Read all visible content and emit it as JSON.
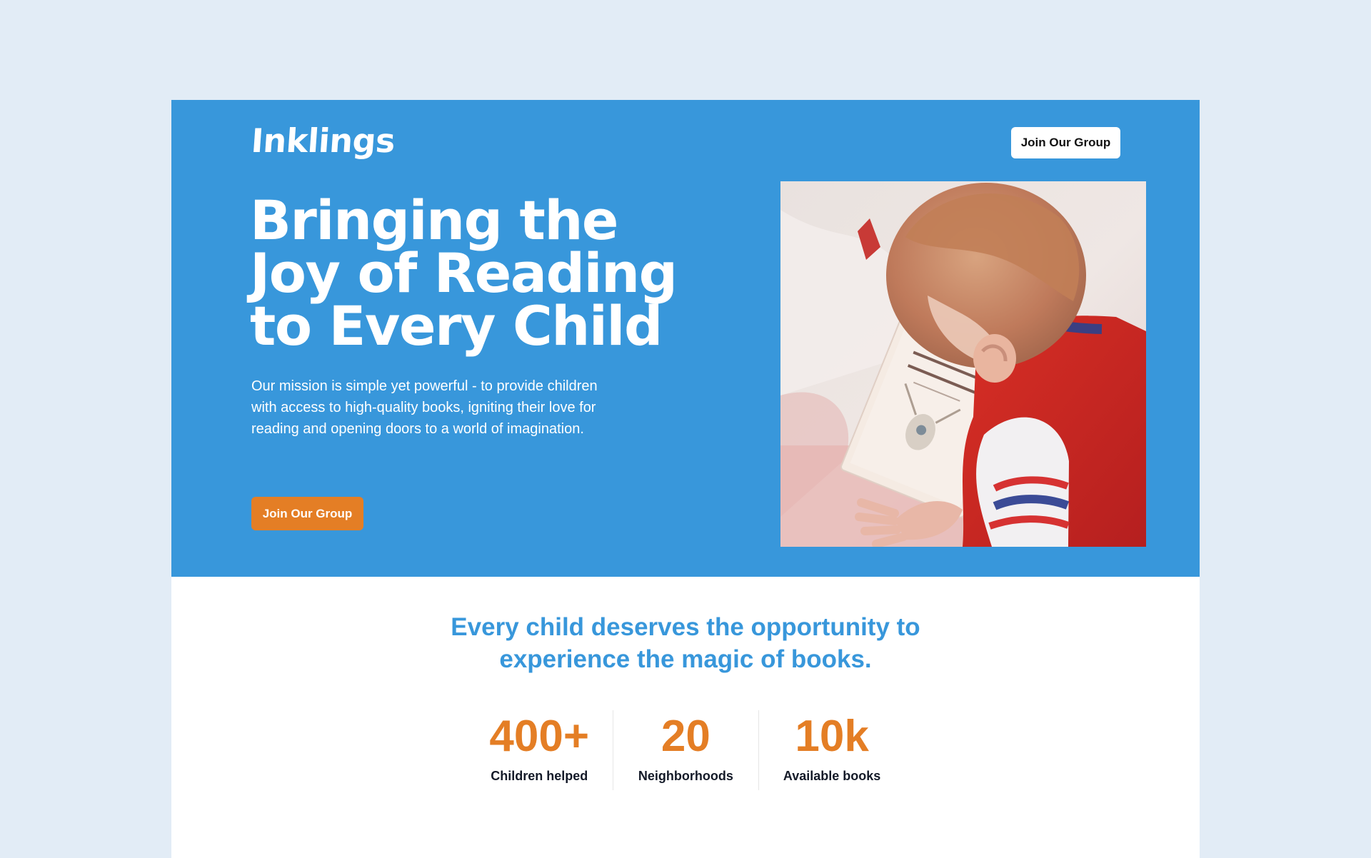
{
  "brand": {
    "logo_text": "Inklings",
    "colors": {
      "page_background": "#e2ecf6",
      "hero_blue": "#3897db",
      "accent_orange": "#e47e25"
    }
  },
  "header": {
    "cta_label": "Join Our Group"
  },
  "hero": {
    "headline_lines": [
      "Bringing the",
      "Joy of Reading",
      "to Every Child"
    ],
    "mission": "Our mission is simple yet powerful - to provide children with access to high-quality books, igniting their love for reading and opening doors to a world of imagination.",
    "cta_label": "Join Our Group",
    "image": "baby-reading-book-photo"
  },
  "tagline": {
    "lines": [
      "Every child deserves the opportunity to",
      "experience the magic of books."
    ]
  },
  "stats": [
    {
      "value": "400+",
      "label": "Children helped"
    },
    {
      "value": "20",
      "label": "Neighborhoods"
    },
    {
      "value": "10k",
      "label": "Available books"
    }
  ]
}
